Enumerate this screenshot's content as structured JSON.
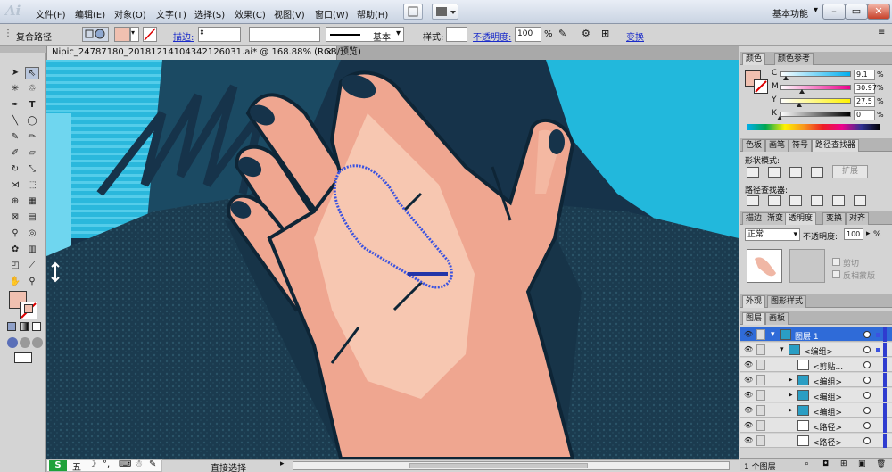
{
  "app": {
    "logo": "Ai",
    "workspace": "基本功能"
  },
  "menu": [
    "文件(F)",
    "编辑(E)",
    "对象(O)",
    "文字(T)",
    "选择(S)",
    "效果(C)",
    "视图(V)",
    "窗口(W)",
    "帮助(H)"
  ],
  "controlbar": {
    "selection_type": "复合路径",
    "stroke_label": "描边:",
    "stroke_style": "基本",
    "style_label": "样式:",
    "opacity_label": "不透明度:",
    "opacity_value": "100",
    "opacity_unit": "%",
    "transform_label": "变换"
  },
  "document": {
    "tab_title": "Nipic_24787180_20181214104342126031.ai* @ 168.88% (RGB/预览)",
    "close": "×"
  },
  "statusbar": {
    "tool_name": "直接选择"
  },
  "ime": {
    "logo": "S",
    "mode": "五",
    "items": [
      "☽",
      "°,",
      "⌨",
      "☃",
      "✎"
    ]
  },
  "color_panel": {
    "tabs": [
      "颜色",
      "颜色参考"
    ],
    "channels": [
      {
        "name": "C",
        "value": "9.1",
        "level": 0.091
      },
      {
        "name": "M",
        "value": "30.97",
        "level": 0.31
      },
      {
        "name": "Y",
        "value": "27.5",
        "level": 0.275
      },
      {
        "name": "K",
        "value": "0",
        "level": 0
      }
    ],
    "pct": "%",
    "fill_color": "#f0c0b0"
  },
  "pathfinder_panel": {
    "tabs": [
      "色板",
      "画笔",
      "符号",
      "路径查找器"
    ],
    "shape_modes_label": "形状模式:",
    "expand_label": "扩展",
    "pathfinders_label": "路径查找器:"
  },
  "transparency_panel": {
    "tabs": [
      "描边",
      "渐变",
      "透明度",
      "变换",
      "对齐"
    ],
    "blend_mode": "正常",
    "opacity_label": "不透明度:",
    "opacity_value": "100",
    "pct": "%",
    "clip_label": "剪切",
    "invert_label": "反相蒙版"
  },
  "appearance_tabs": [
    "外观",
    "图形样式"
  ],
  "layers_panel": {
    "tabs": [
      "图层",
      "画板"
    ],
    "rows": [
      {
        "name": "图层 1",
        "indent": 0,
        "kind": "layer"
      },
      {
        "name": "<编组>",
        "indent": 1,
        "kind": "group"
      },
      {
        "name": "<剪贴...",
        "indent": 2,
        "kind": "clip"
      },
      {
        "name": "<编组>",
        "indent": 2,
        "kind": "group"
      },
      {
        "name": "<编组>",
        "indent": 2,
        "kind": "group"
      },
      {
        "name": "<编组>",
        "indent": 2,
        "kind": "group"
      },
      {
        "name": "<路径>",
        "indent": 2,
        "kind": "path"
      },
      {
        "name": "<路径>",
        "indent": 2,
        "kind": "path"
      }
    ],
    "footer": "1 个图层"
  },
  "colors": {
    "accent": "#2f3ccf",
    "skin": "#efa690",
    "skin_light": "#f7c7b1",
    "navy": "#16334a",
    "cyan": "#21b6d8",
    "selection": "#3a52e0"
  }
}
